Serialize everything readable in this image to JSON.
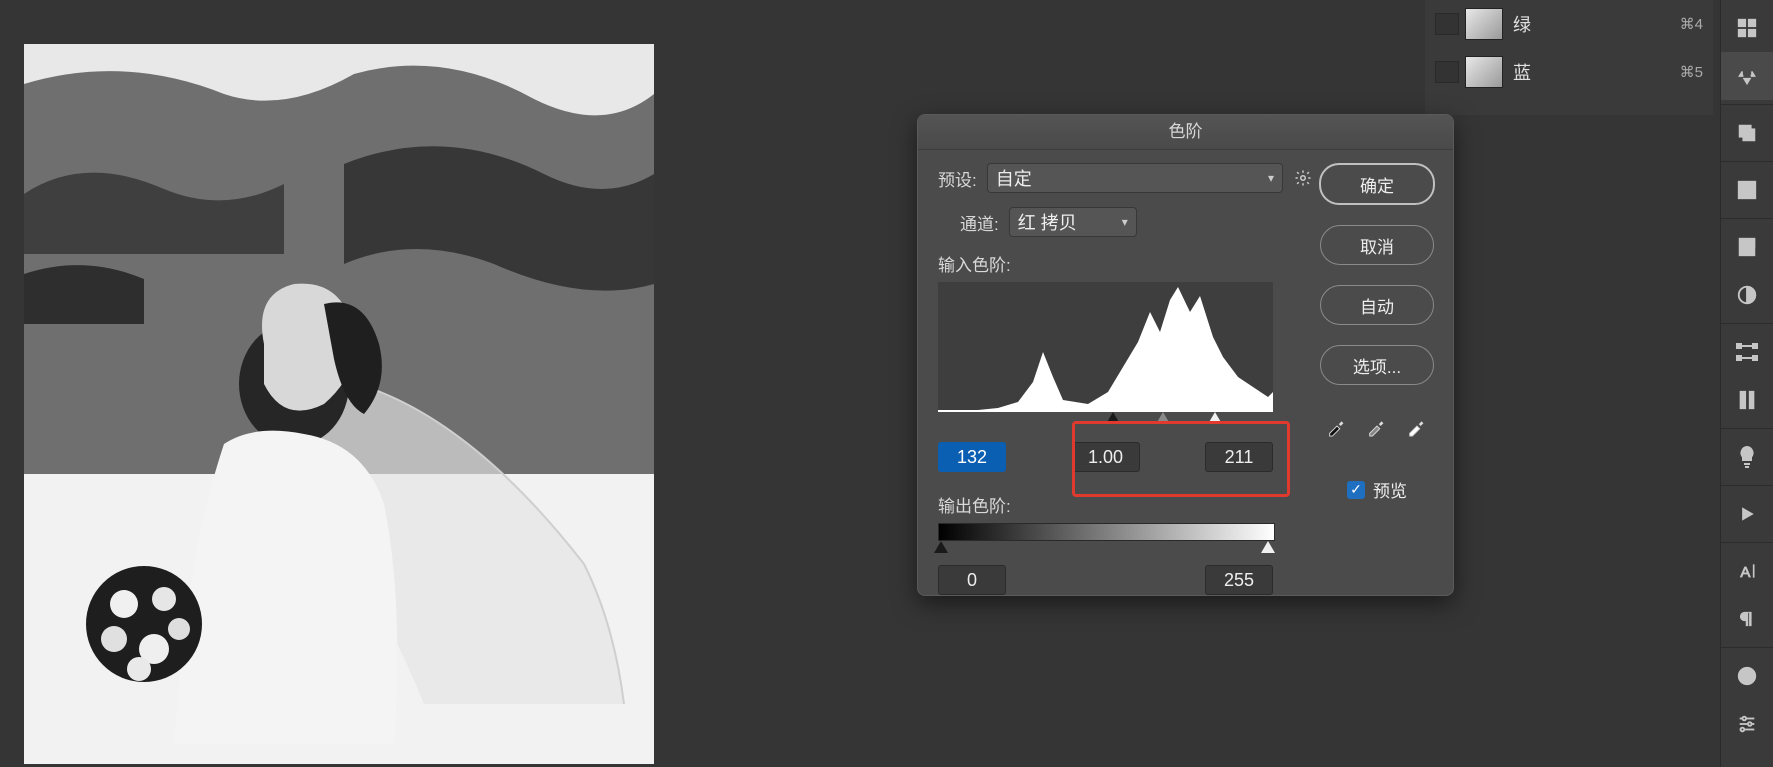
{
  "channels_panel": {
    "rows": [
      {
        "name": "绿",
        "shortcut": "⌘4"
      },
      {
        "name": "蓝",
        "shortcut": "⌘5"
      }
    ]
  },
  "levels_dialog": {
    "title": "色阶",
    "preset_label": "预设:",
    "preset_value": "自定",
    "channel_label": "通道:",
    "channel_value": "红 拷贝",
    "input_label": "输入色阶:",
    "input_shadow": "132",
    "input_mid": "1.00",
    "input_highlight": "211",
    "output_label": "输出色阶:",
    "output_shadow": "0",
    "output_highlight": "255",
    "buttons": {
      "ok": "确定",
      "cancel": "取消",
      "auto": "自动",
      "options": "选项..."
    },
    "preview_label": "预览",
    "preview_checked": true
  },
  "right_bar_icons": [
    "grid-icon",
    "recycle-icon",
    "layers-panel-icon",
    "table-icon",
    "bookmark-icon",
    "contrast-icon",
    "transform-icon",
    "ruler-icon",
    "lightbulb-icon",
    "play-icon",
    "text-a-icon",
    "paragraph-icon",
    "info-icon",
    "sliders-icon"
  ]
}
